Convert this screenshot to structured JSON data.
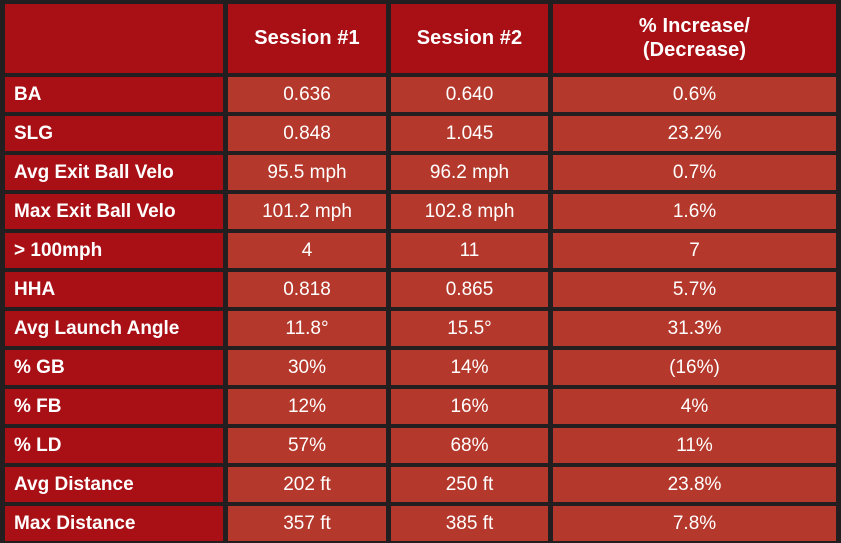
{
  "table": {
    "columns": [
      {
        "key": "metric",
        "label": ""
      },
      {
        "key": "session1",
        "label": "Session #1"
      },
      {
        "key": "session2",
        "label": "Session #2"
      },
      {
        "key": "delta",
        "label_line1": "% Increase/",
        "label_line2": "(Decrease)"
      }
    ],
    "rows": [
      {
        "metric": "BA",
        "session1": "0.636",
        "session2": "0.640",
        "delta": "0.6%"
      },
      {
        "metric": "SLG",
        "session1": "0.848",
        "session2": "1.045",
        "delta": "23.2%"
      },
      {
        "metric": "Avg Exit Ball Velo",
        "session1": "95.5 mph",
        "session2": "96.2 mph",
        "delta": "0.7%"
      },
      {
        "metric": "Max Exit Ball Velo",
        "session1": "101.2 mph",
        "session2": "102.8 mph",
        "delta": "1.6%"
      },
      {
        "metric": "> 100mph",
        "session1": "4",
        "session2": "11",
        "delta": "7"
      },
      {
        "metric": "HHA",
        "session1": "0.818",
        "session2": "0.865",
        "delta": "5.7%"
      },
      {
        "metric": "Avg Launch Angle",
        "session1": "11.8°",
        "session2": "15.5°",
        "delta": "31.3%"
      },
      {
        "metric": "% GB",
        "session1": "30%",
        "session2": "14%",
        "delta": "(16%)"
      },
      {
        "metric": "% FB",
        "session1": "12%",
        "session2": "16%",
        "delta": "4%"
      },
      {
        "metric": "% LD",
        "session1": "57%",
        "session2": "68%",
        "delta": "11%"
      },
      {
        "metric": "Avg Distance",
        "session1": "202 ft",
        "session2": "250 ft",
        "delta": "23.8%"
      },
      {
        "metric": "Max Distance",
        "session1": "357 ft",
        "session2": "385 ft",
        "delta": "7.8%"
      }
    ]
  },
  "colors": {
    "grid": "#231f20",
    "header_red": "#a81016",
    "label_red": "#a81016",
    "value_red": "#b4392c",
    "text": "#ffffff"
  }
}
